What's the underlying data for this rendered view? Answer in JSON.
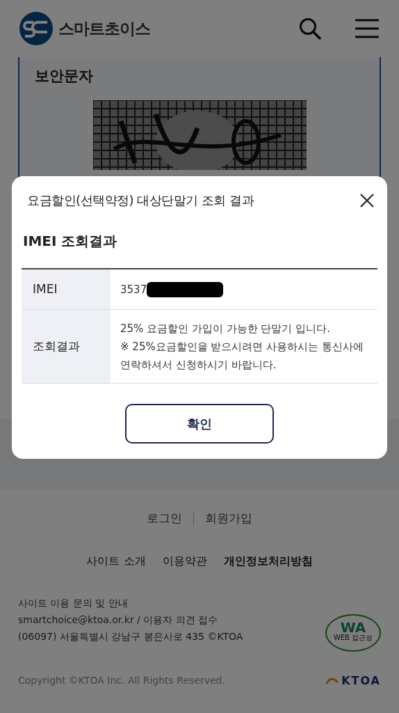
{
  "header": {
    "logo_text": "스마트초이스"
  },
  "section": {
    "title": "보안문자"
  },
  "modal": {
    "title": "요금할인(선택약정) 대상단말기 조회 결과",
    "subtitle": "IMEI 조회결과",
    "rows": [
      {
        "label": "IMEI",
        "value": "3537",
        "redacted": true
      },
      {
        "label": "조회결과",
        "lines": [
          "25% 요금할인 가입이 가능한 단말기 입니다.",
          "※ 25%요금할인을 받으시려면 사용하시는 통신사에 연락하셔서 신청하시기 바랍니다."
        ]
      }
    ],
    "button": "확인"
  },
  "footer": {
    "auth_links": [
      "로그인",
      "회원가입"
    ],
    "links": [
      {
        "label": "사이트 소개",
        "bold": false
      },
      {
        "label": "이용약관",
        "bold": false
      },
      {
        "label": "개인정보처리방침",
        "bold": true
      }
    ],
    "info": [
      "사이트 이용 문의 및 안내",
      "smartchoice@ktoa.or.kr / 이용자 의견 접수",
      "(06097) 서울특별시 강남구 봉은사로 435 ©KTOA"
    ],
    "copyright": "Copyright ©KTOA Inc. All Rights Reserved.",
    "wa_mark": {
      "text": "WA",
      "caption": "WEB 접근성"
    },
    "ktoa_logo": "KTOA"
  }
}
